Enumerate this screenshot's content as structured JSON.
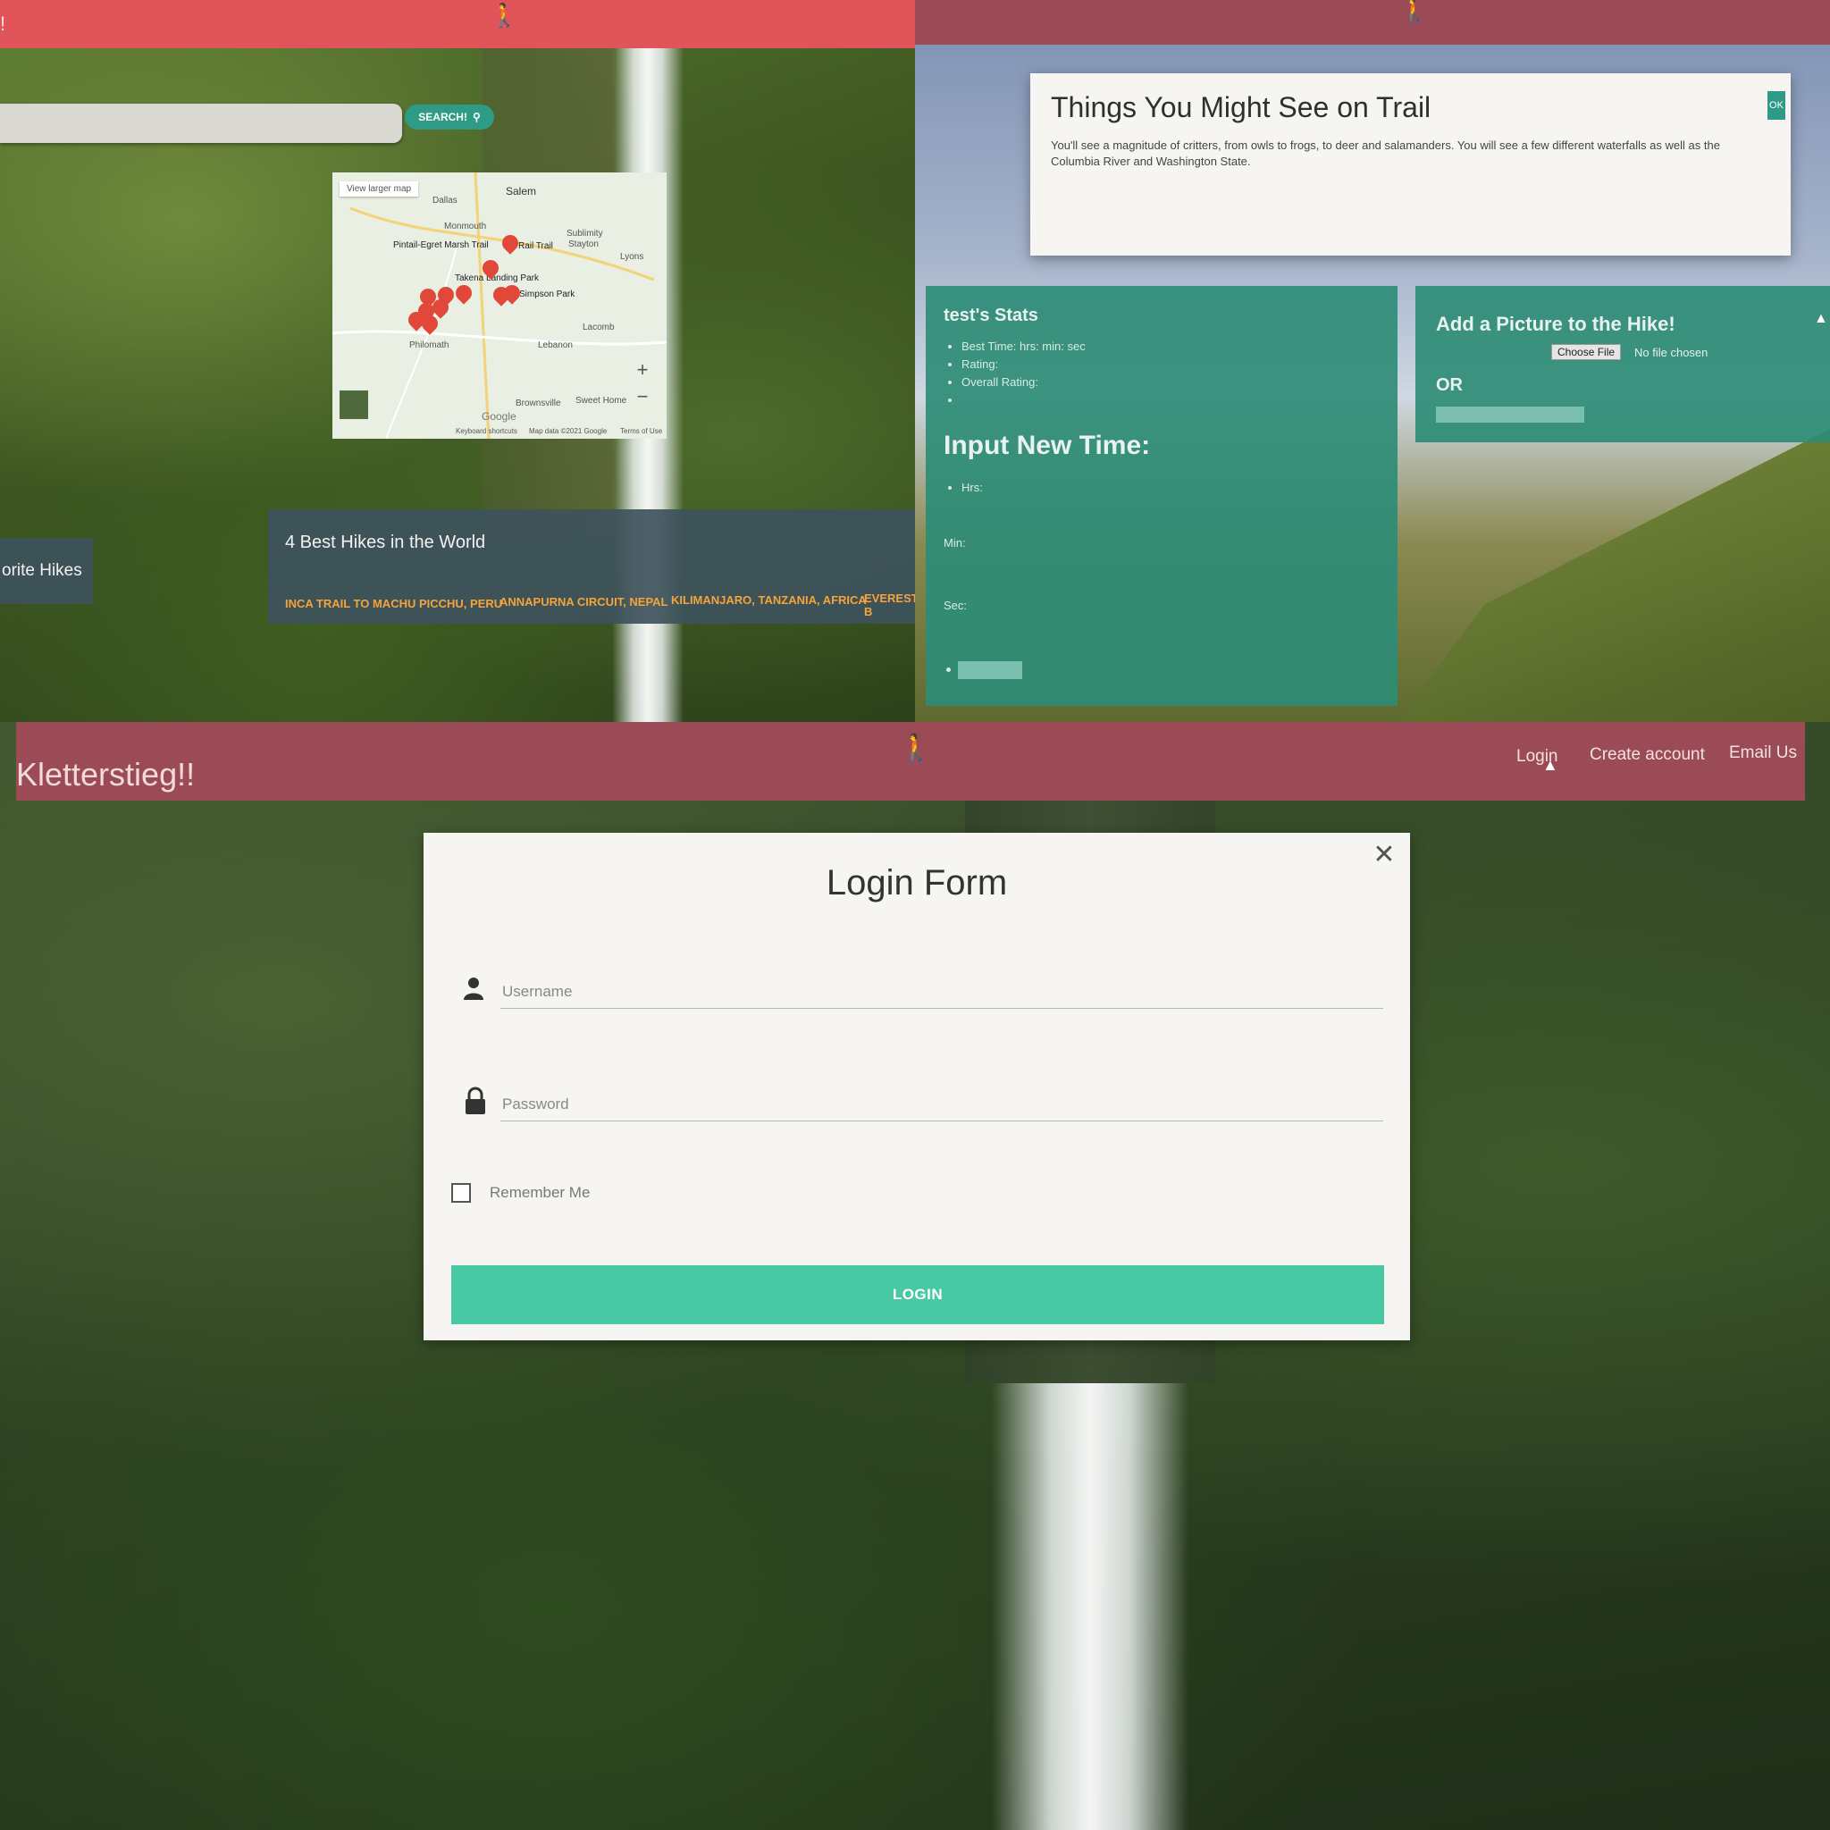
{
  "panel_search": {
    "bang": "!",
    "search_button": "SEARCH!",
    "map": {
      "view_larger": "View larger map",
      "labels": [
        "Salem",
        "Dallas",
        "Monmouth",
        "Pintail-Egret Marsh Trail",
        "Rail Trail",
        "Sublimity",
        "Stayton",
        "Takena Landing Park",
        "Simpson Park",
        "Lyons",
        "Lacomb",
        "Philomath",
        "Lebanon",
        "Sweet Home",
        "Brownsville"
      ],
      "zoom_in": "+",
      "zoom_out": "−",
      "brand": "Google",
      "footer": [
        "Keyboard shortcuts",
        "Map data ©2021 Google",
        "Terms of Use"
      ]
    },
    "favorite_tab": "orite Hikes",
    "best_hikes": {
      "title": "4 Best Hikes in the World",
      "links": [
        "INCA TRAIL TO MACHU PICCHU, PERU",
        "ANNAPURNA CIRCUIT, NEPAL",
        "KILIMANJARO, TANZANIA, AFRICA",
        "EVEREST B"
      ]
    }
  },
  "panel_trail": {
    "modal": {
      "title": "Things You Might See on Trail",
      "body": "You'll see a magnitude of critters, from owls to frogs, to deer and salamanders. You will see a few different waterfalls as well as the Columbia River and Washington State.",
      "ok": "OK"
    },
    "stats": {
      "title": "test's Stats",
      "items": [
        "Best Time: hrs: min: sec",
        "Rating:",
        "Overall Rating:",
        ""
      ],
      "input_title": "Input New Time:",
      "hrs": "Hrs:",
      "min": "Min:",
      "sec": "Sec:"
    },
    "picture": {
      "title": "Add a Picture to the Hike!",
      "choose_file": "Choose File",
      "no_file": "No file chosen",
      "or": "OR"
    }
  },
  "panel_login": {
    "brand": "Kletterstieg!!",
    "nav": [
      "Login",
      "Create account",
      "Email Us"
    ],
    "form": {
      "title": "Login Form",
      "username_placeholder": "Username",
      "password_placeholder": "Password",
      "remember": "Remember Me",
      "submit": "LOGIN"
    }
  },
  "colors": {
    "red_bar": "#e0545a",
    "maroon_bar": "#9b4b55",
    "teal": "#2e8c76",
    "login_button": "#48c9a4",
    "map_pin": "#e2483a",
    "link_orange": "#f6a33b"
  },
  "icons": [
    "hiker-icon",
    "search-icon",
    "map-pin-icon",
    "close-icon",
    "user-icon",
    "lock-icon",
    "checkbox-icon",
    "mouse-cursor-icon"
  ]
}
